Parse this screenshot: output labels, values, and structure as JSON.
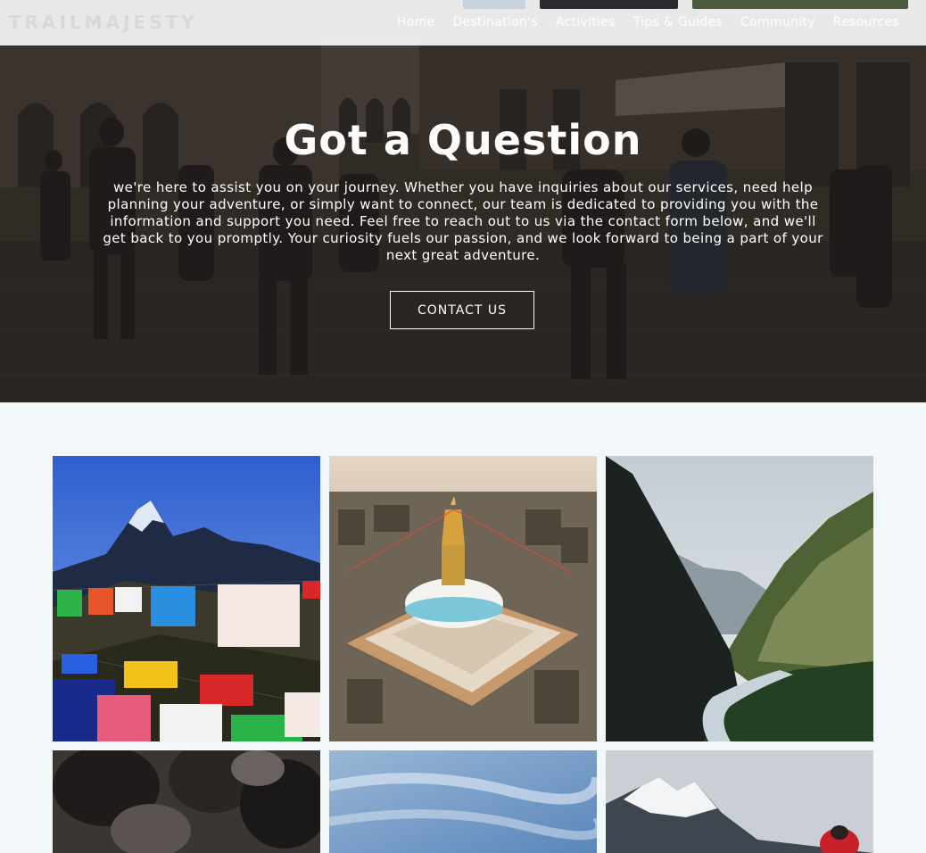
{
  "header": {
    "logo_text": "TRAILMAJESTY",
    "nav": [
      "Home",
      "Destination's",
      "Activities",
      "Tips & Guides",
      "Community",
      "Resources"
    ]
  },
  "hero": {
    "title": "Got a Question",
    "body": "we're here to assist you on your journey. Whether you have inquiries about our services, need help planning your adventure, or simply want to connect, our team is dedicated to providing you with the information and support you need. Feel free to reach out to us via the contact form below, and we'll get back to you promptly. Your curiosity fuels our passion, and we look forward to being a part of your next great adventure.",
    "button_label": "CONTACT US"
  },
  "gallery": {
    "images": [
      {
        "subject": "mountain-prayer-flags-photo"
      },
      {
        "subject": "boudhanath-stupa-photo"
      },
      {
        "subject": "river-valley-photo"
      },
      {
        "subject": "blurred-crowd-photo"
      },
      {
        "subject": "blue-sky-clouds-photo"
      },
      {
        "subject": "snowy-peak-trekker-photo"
      }
    ]
  },
  "colors": {
    "page_bg": "#f2f8fa",
    "nav_bg": "#f6f6f8",
    "text_light": "#ffffff"
  }
}
